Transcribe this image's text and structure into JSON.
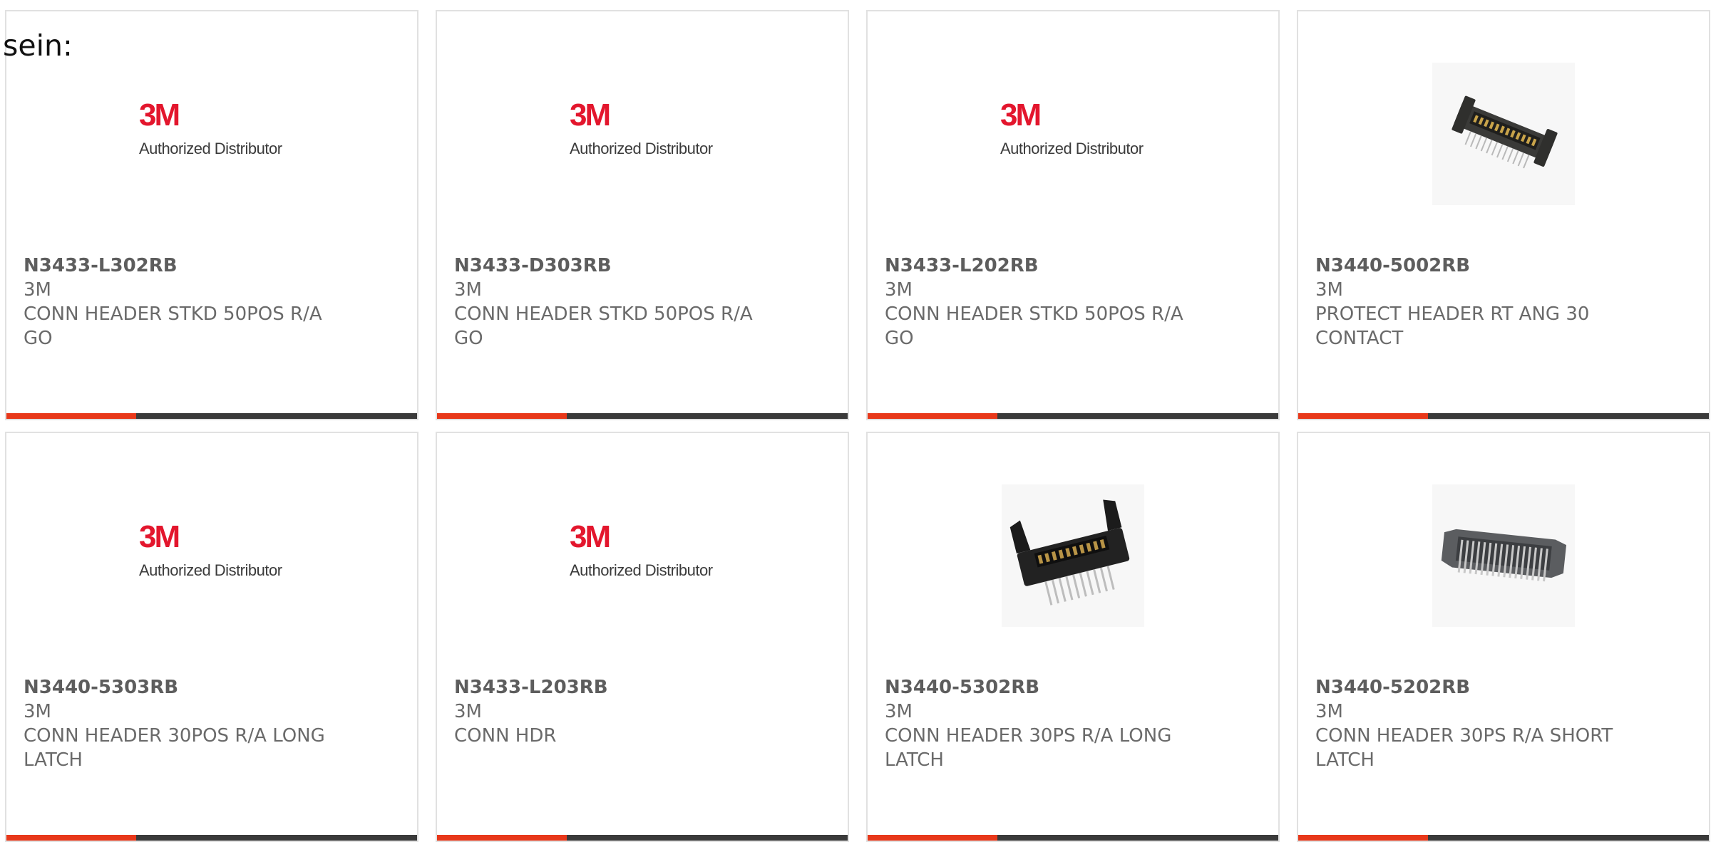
{
  "intro_text": "sein:",
  "logo": {
    "mark": "3M",
    "subtitle": "Authorized Distributor"
  },
  "colors": {
    "accent": "#e8381a",
    "bar": "#3a3a3a",
    "border": "#e1e1e1",
    "text": "#6a6a6a"
  },
  "products": [
    {
      "part_number": "N3433-L302RB",
      "manufacturer": "3M",
      "description": "CONN HEADER STKD 50POS R/A GO",
      "image": "3m-logo"
    },
    {
      "part_number": "N3433-D303RB",
      "manufacturer": "3M",
      "description": "CONN HEADER STKD 50POS R/A GO",
      "image": "3m-logo"
    },
    {
      "part_number": "N3433-L202RB",
      "manufacturer": "3M",
      "description": "CONN HEADER STKD 50POS R/A GO",
      "image": "3m-logo"
    },
    {
      "part_number": "N3440-5002RB",
      "manufacturer": "3M",
      "description": "PROTECT HEADER RT ANG 30 CONTACT",
      "image": "header-photo"
    },
    {
      "part_number": "N3440-5303RB",
      "manufacturer": "3M",
      "description": "CONN HEADER 30POS R/A LONG LATCH",
      "image": "3m-logo"
    },
    {
      "part_number": "N3433-L203RB",
      "manufacturer": "3M",
      "description": "CONN HDR",
      "image": "3m-logo"
    },
    {
      "part_number": "N3440-5302RB",
      "manufacturer": "3M",
      "description": "CONN HEADER 30PS R/A LONG LATCH",
      "image": "latch-header-photo"
    },
    {
      "part_number": "N3440-5202RB",
      "manufacturer": "3M",
      "description": "CONN HEADER 30PS R/A SHORT LATCH",
      "image": "short-latch-header-photo"
    }
  ]
}
